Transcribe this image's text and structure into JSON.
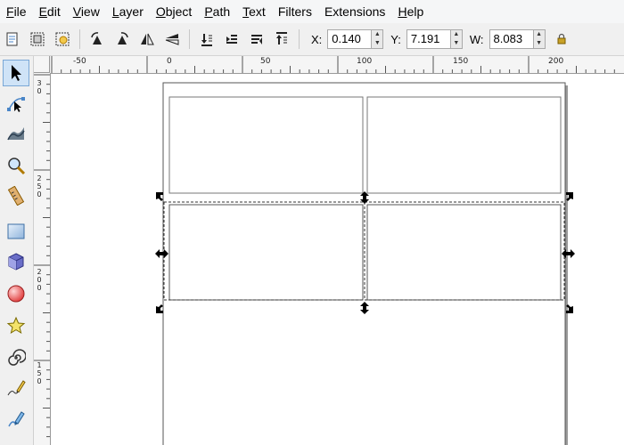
{
  "menu": [
    {
      "ul": "F",
      "rest": "ile"
    },
    {
      "ul": "E",
      "rest": "dit"
    },
    {
      "ul": "V",
      "rest": "iew"
    },
    {
      "ul": "L",
      "rest": "ayer"
    },
    {
      "ul": "O",
      "rest": "bject"
    },
    {
      "ul": "P",
      "rest": "ath"
    },
    {
      "ul": "T",
      "rest": "ext"
    },
    {
      "ul": "",
      "rest": "Filters"
    },
    {
      "ul": "",
      "rest": "Extensions"
    },
    {
      "ul": "H",
      "rest": "elp"
    }
  ],
  "coords": {
    "x_label": "X:",
    "x_value": "0.140",
    "y_label": "Y:",
    "y_value": "7.191",
    "w_label": "W:",
    "w_value": "8.083"
  },
  "hruler_labels": [
    "-50",
    "0",
    "50",
    "100",
    "150",
    "200"
  ],
  "vruler_labels": [
    "3",
    "0",
    "2",
    "5",
    "0",
    "2",
    "0",
    "0",
    "1",
    "5",
    "0"
  ],
  "tools": [
    "selector-arrow-icon",
    "node-editor-icon",
    "tweak-icon",
    "zoom-icon",
    "measure-icon",
    "rectangle-icon",
    "3d-box-icon",
    "ellipse-icon",
    "star-icon",
    "spiral-icon",
    "pencil-icon",
    "pen-icon"
  ],
  "accent_color": "#4a86c8"
}
